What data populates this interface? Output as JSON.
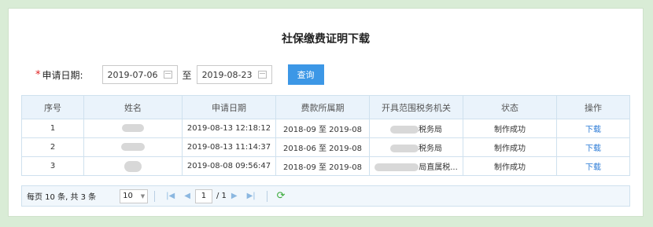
{
  "title": "社保缴费证明下载",
  "filter": {
    "required_mark": "*",
    "label": "申请日期:",
    "start_date": "2019-07-06",
    "separator": "至",
    "end_date": "2019-08-23",
    "query_label": "查询"
  },
  "table": {
    "headers": [
      "序号",
      "姓名",
      "申请日期",
      "费款所属期",
      "开具范围税务机关",
      "状态",
      "操作"
    ],
    "rows": [
      {
        "no": "1",
        "apply_date": "2019-08-13 12:18:12",
        "period": "2018-09 至 2019-08",
        "office": "税务局",
        "status": "制作成功",
        "action": "下载"
      },
      {
        "no": "2",
        "apply_date": "2019-08-13 11:14:37",
        "period": "2018-06 至 2019-08",
        "office": "税务局",
        "status": "制作成功",
        "action": "下载"
      },
      {
        "no": "3",
        "apply_date": "2019-08-08 09:56:47",
        "period": "2018-09 至 2019-08",
        "office": "局直属税...",
        "status": "制作成功",
        "action": "下载"
      }
    ]
  },
  "pager": {
    "summary": "每页 10 条, 共 3 条",
    "page_size": "10",
    "current_page": "1",
    "total_pages": "/ 1"
  },
  "icons": {
    "first": "first-page-icon",
    "prev": "prev-page-icon",
    "next": "next-page-icon",
    "last": "last-page-icon",
    "refresh": "refresh-icon",
    "calendar": "calendar-icon"
  },
  "colors": {
    "accent": "#3c97e6",
    "link": "#2a7ad6",
    "required": "#e02020",
    "header_bg": "#eaf3fb"
  }
}
